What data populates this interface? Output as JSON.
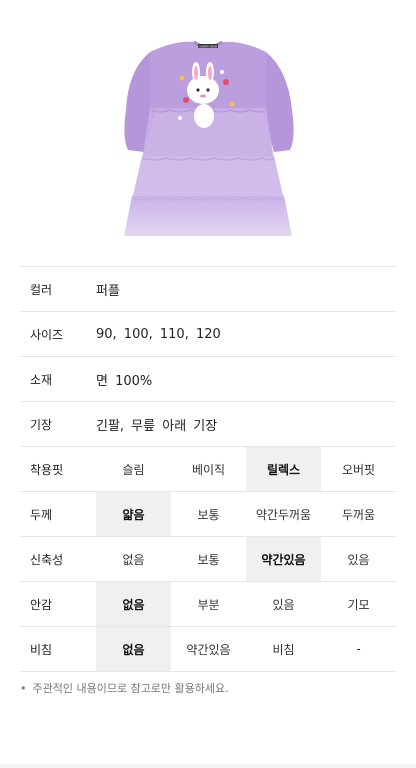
{
  "product": {
    "brand_tag": "CHERRY BEAR"
  },
  "specs": {
    "color": {
      "label": "컬러",
      "value": "퍼플"
    },
    "size": {
      "label": "사이즈",
      "value": "90,  100, 110,  120"
    },
    "material": {
      "label": "소재",
      "value": "면 100%"
    },
    "length": {
      "label": "기장",
      "value": "긴팔,  무릎 아래 기장"
    },
    "fit": {
      "label": "착용핏",
      "options": [
        "슬림",
        "베이직",
        "릴렉스",
        "오버핏"
      ],
      "selected_index": 2
    },
    "thickness": {
      "label": "두께",
      "options": [
        "얇음",
        "보통",
        "약간두꺼움",
        "두꺼움"
      ],
      "selected_index": 0
    },
    "stretch": {
      "label": "신축성",
      "options": [
        "없음",
        "보통",
        "약간있음",
        "있음"
      ],
      "selected_index": 2
    },
    "lining": {
      "label": "안감",
      "options": [
        "없음",
        "부분",
        "있음",
        "기모"
      ],
      "selected_index": 0
    },
    "sheer": {
      "label": "비침",
      "options": [
        "없음",
        "약간있음",
        "비침",
        "-"
      ],
      "selected_index": 0
    }
  },
  "note": {
    "bullet": "•",
    "text": "주관적인 내용이므로 참고로만 활용하세요."
  },
  "colors": {
    "dress_purple": "#b79ad9",
    "tulle_light": "#d9c7ef",
    "selected_bg": "#f0f0f0",
    "border": "#e6e6e6"
  }
}
